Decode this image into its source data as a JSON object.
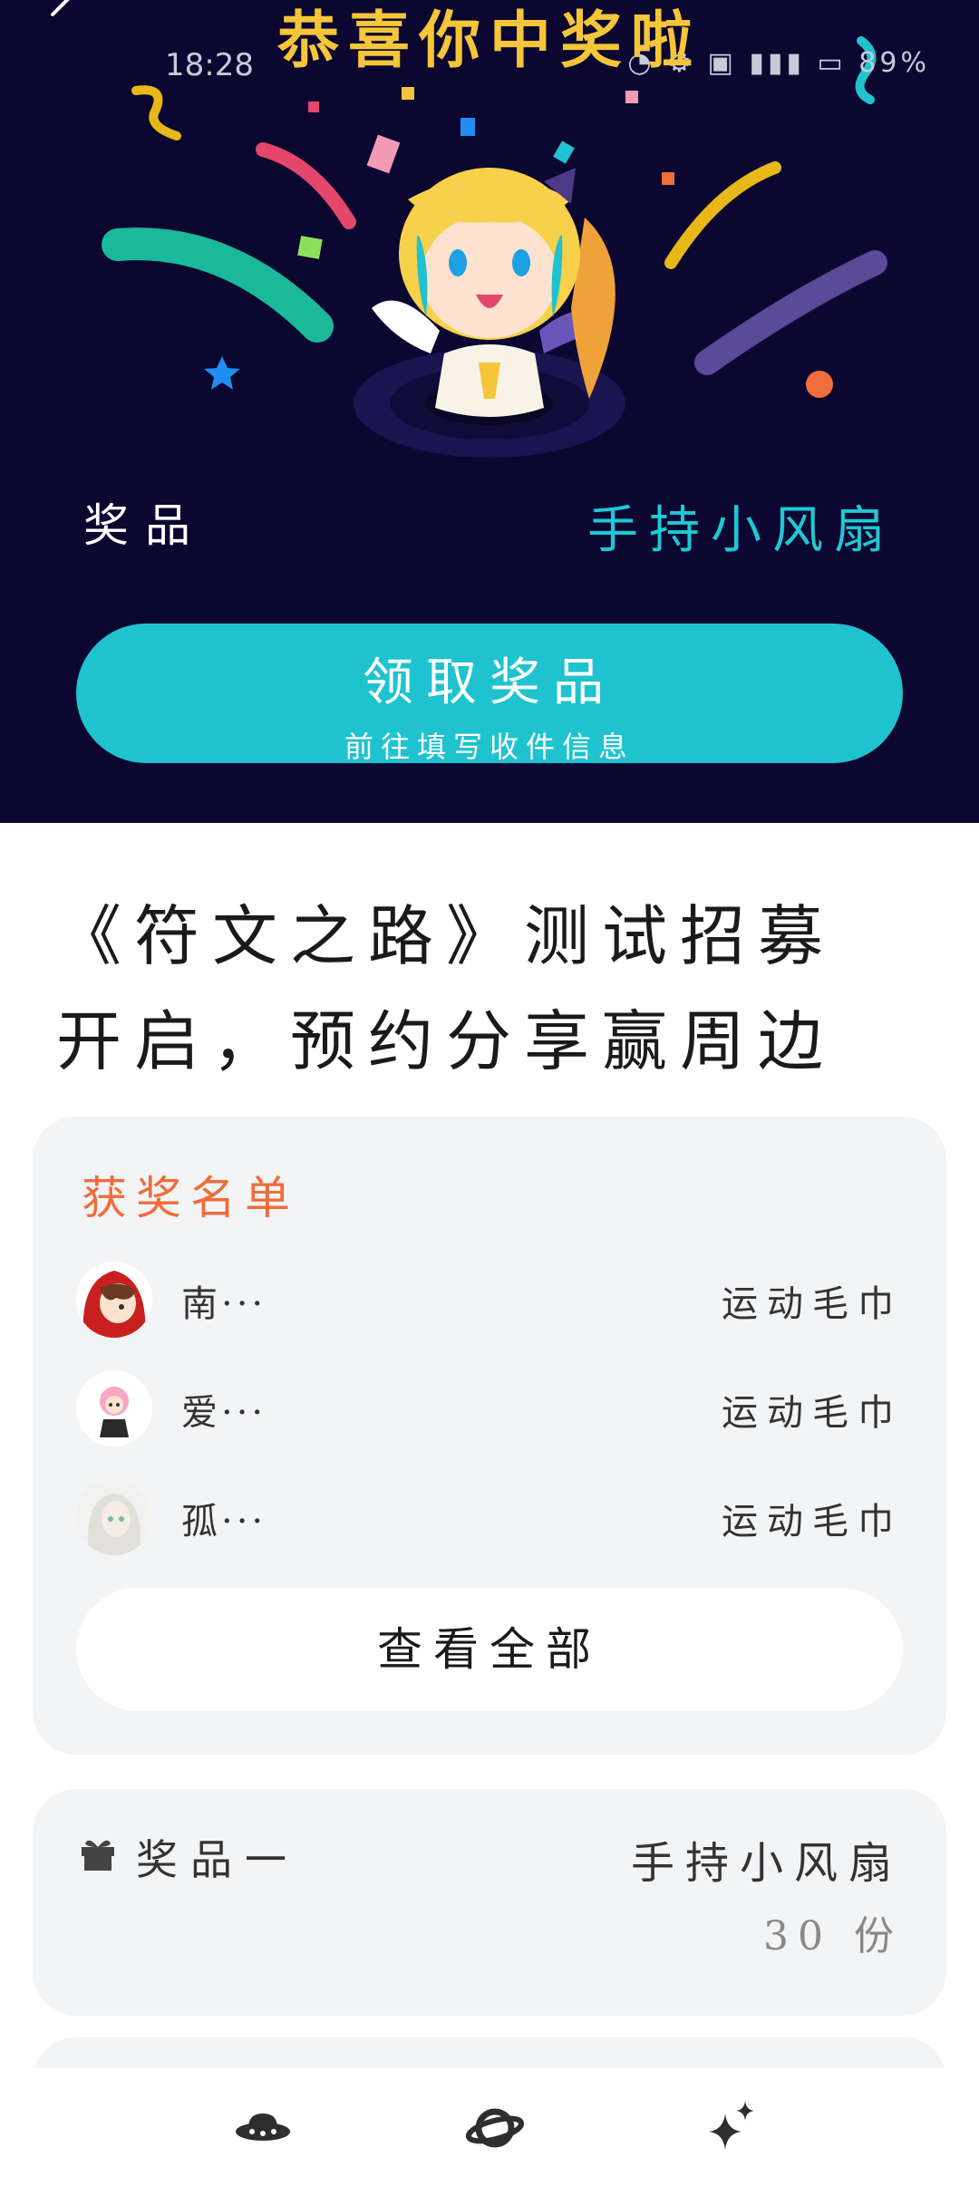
{
  "status_bar": {
    "time": "18:28",
    "icons_text": "◔ ⚙ ▣ ▮▮▮ ▭ 89%"
  },
  "hero": {
    "title": "恭喜你中奖啦",
    "prize_label": "奖品",
    "prize_name": "手持小风扇",
    "claim_button": {
      "label": "领取奖品",
      "sublabel": "前往填写收件信息"
    },
    "colors": {
      "background": "#0b0730",
      "accent": "#1ec3cf",
      "title": "#f5c53a"
    }
  },
  "article": {
    "title": "《符文之路》测试招募开启，预约分享赢周边"
  },
  "winners": {
    "heading": "获奖名单",
    "rows": [
      {
        "name": "南···",
        "prize": "运动毛巾",
        "avatar": "red-hood-avatar"
      },
      {
        "name": "爱···",
        "prize": "运动毛巾",
        "avatar": "pink-hair-avatar"
      },
      {
        "name": "孤···",
        "prize": "运动毛巾",
        "avatar": "pale-hair-avatar"
      }
    ],
    "view_all_label": "查看全部"
  },
  "prizes": [
    {
      "label": "奖品一",
      "name": "手持小风扇",
      "quantity": "30 份",
      "icon": "gift-icon"
    }
  ],
  "bottom_nav": {
    "items": [
      {
        "icon": "ufo-icon"
      },
      {
        "icon": "planet-icon"
      },
      {
        "icon": "sparkles-icon"
      }
    ]
  }
}
